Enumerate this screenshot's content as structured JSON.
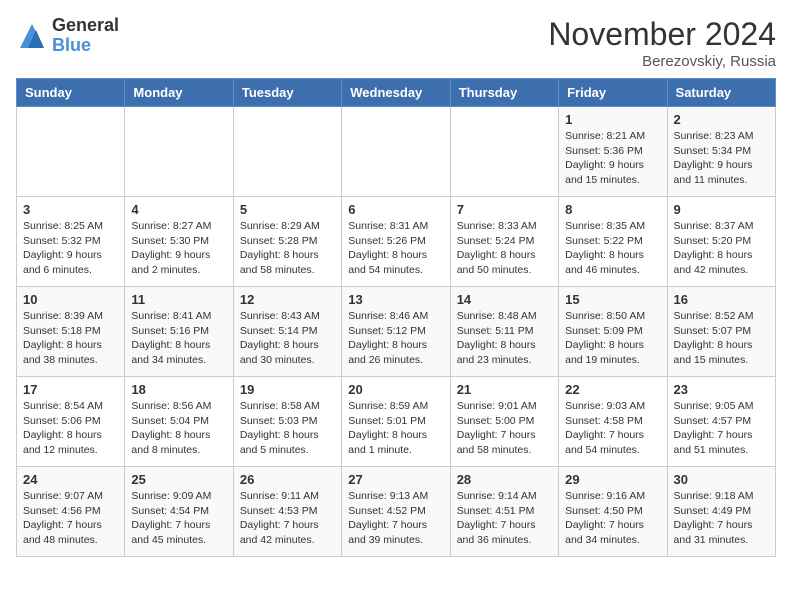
{
  "logo": {
    "general": "General",
    "blue": "Blue"
  },
  "title": "November 2024",
  "location": "Berezovskiy, Russia",
  "days_of_week": [
    "Sunday",
    "Monday",
    "Tuesday",
    "Wednesday",
    "Thursday",
    "Friday",
    "Saturday"
  ],
  "weeks": [
    [
      {
        "day": "",
        "info": ""
      },
      {
        "day": "",
        "info": ""
      },
      {
        "day": "",
        "info": ""
      },
      {
        "day": "",
        "info": ""
      },
      {
        "day": "",
        "info": ""
      },
      {
        "day": "1",
        "info": "Sunrise: 8:21 AM\nSunset: 5:36 PM\nDaylight: 9 hours and 15 minutes."
      },
      {
        "day": "2",
        "info": "Sunrise: 8:23 AM\nSunset: 5:34 PM\nDaylight: 9 hours and 11 minutes."
      }
    ],
    [
      {
        "day": "3",
        "info": "Sunrise: 8:25 AM\nSunset: 5:32 PM\nDaylight: 9 hours and 6 minutes."
      },
      {
        "day": "4",
        "info": "Sunrise: 8:27 AM\nSunset: 5:30 PM\nDaylight: 9 hours and 2 minutes."
      },
      {
        "day": "5",
        "info": "Sunrise: 8:29 AM\nSunset: 5:28 PM\nDaylight: 8 hours and 58 minutes."
      },
      {
        "day": "6",
        "info": "Sunrise: 8:31 AM\nSunset: 5:26 PM\nDaylight: 8 hours and 54 minutes."
      },
      {
        "day": "7",
        "info": "Sunrise: 8:33 AM\nSunset: 5:24 PM\nDaylight: 8 hours and 50 minutes."
      },
      {
        "day": "8",
        "info": "Sunrise: 8:35 AM\nSunset: 5:22 PM\nDaylight: 8 hours and 46 minutes."
      },
      {
        "day": "9",
        "info": "Sunrise: 8:37 AM\nSunset: 5:20 PM\nDaylight: 8 hours and 42 minutes."
      }
    ],
    [
      {
        "day": "10",
        "info": "Sunrise: 8:39 AM\nSunset: 5:18 PM\nDaylight: 8 hours and 38 minutes."
      },
      {
        "day": "11",
        "info": "Sunrise: 8:41 AM\nSunset: 5:16 PM\nDaylight: 8 hours and 34 minutes."
      },
      {
        "day": "12",
        "info": "Sunrise: 8:43 AM\nSunset: 5:14 PM\nDaylight: 8 hours and 30 minutes."
      },
      {
        "day": "13",
        "info": "Sunrise: 8:46 AM\nSunset: 5:12 PM\nDaylight: 8 hours and 26 minutes."
      },
      {
        "day": "14",
        "info": "Sunrise: 8:48 AM\nSunset: 5:11 PM\nDaylight: 8 hours and 23 minutes."
      },
      {
        "day": "15",
        "info": "Sunrise: 8:50 AM\nSunset: 5:09 PM\nDaylight: 8 hours and 19 minutes."
      },
      {
        "day": "16",
        "info": "Sunrise: 8:52 AM\nSunset: 5:07 PM\nDaylight: 8 hours and 15 minutes."
      }
    ],
    [
      {
        "day": "17",
        "info": "Sunrise: 8:54 AM\nSunset: 5:06 PM\nDaylight: 8 hours and 12 minutes."
      },
      {
        "day": "18",
        "info": "Sunrise: 8:56 AM\nSunset: 5:04 PM\nDaylight: 8 hours and 8 minutes."
      },
      {
        "day": "19",
        "info": "Sunrise: 8:58 AM\nSunset: 5:03 PM\nDaylight: 8 hours and 5 minutes."
      },
      {
        "day": "20",
        "info": "Sunrise: 8:59 AM\nSunset: 5:01 PM\nDaylight: 8 hours and 1 minute."
      },
      {
        "day": "21",
        "info": "Sunrise: 9:01 AM\nSunset: 5:00 PM\nDaylight: 7 hours and 58 minutes."
      },
      {
        "day": "22",
        "info": "Sunrise: 9:03 AM\nSunset: 4:58 PM\nDaylight: 7 hours and 54 minutes."
      },
      {
        "day": "23",
        "info": "Sunrise: 9:05 AM\nSunset: 4:57 PM\nDaylight: 7 hours and 51 minutes."
      }
    ],
    [
      {
        "day": "24",
        "info": "Sunrise: 9:07 AM\nSunset: 4:56 PM\nDaylight: 7 hours and 48 minutes."
      },
      {
        "day": "25",
        "info": "Sunrise: 9:09 AM\nSunset: 4:54 PM\nDaylight: 7 hours and 45 minutes."
      },
      {
        "day": "26",
        "info": "Sunrise: 9:11 AM\nSunset: 4:53 PM\nDaylight: 7 hours and 42 minutes."
      },
      {
        "day": "27",
        "info": "Sunrise: 9:13 AM\nSunset: 4:52 PM\nDaylight: 7 hours and 39 minutes."
      },
      {
        "day": "28",
        "info": "Sunrise: 9:14 AM\nSunset: 4:51 PM\nDaylight: 7 hours and 36 minutes."
      },
      {
        "day": "29",
        "info": "Sunrise: 9:16 AM\nSunset: 4:50 PM\nDaylight: 7 hours and 34 minutes."
      },
      {
        "day": "30",
        "info": "Sunrise: 9:18 AM\nSunset: 4:49 PM\nDaylight: 7 hours and 31 minutes."
      }
    ]
  ]
}
